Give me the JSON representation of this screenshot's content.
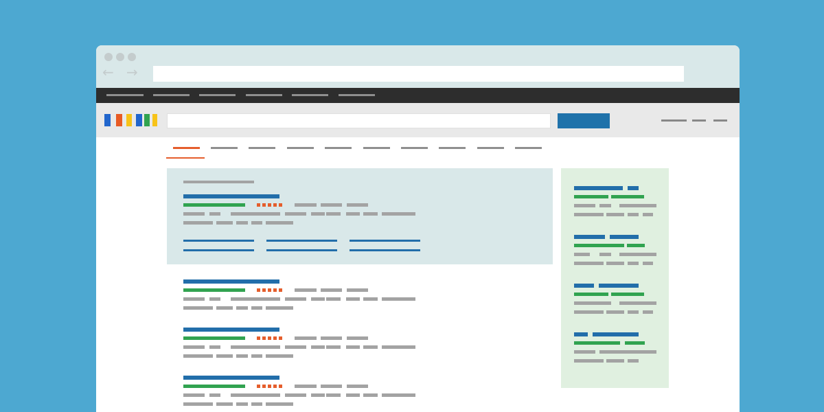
{
  "colors": {
    "background": "#4da8d1",
    "window": "#ffffff",
    "chrome": "#d9e8e9",
    "chrome_dot": "#c4cccd",
    "url_bar": "#ffffff",
    "top_nav": "#2d2d2d",
    "header": "#e9e9e9",
    "search_button": "#1f72aa",
    "accent_orange": "#e55e2c",
    "title_blue": "#226eaa",
    "url_green": "#31a350",
    "snippet_gray": "#a3a3a3",
    "featured_bg": "#d9e8e9",
    "sidebar_bg": "#e0f0e0"
  },
  "icons": {
    "back": "←",
    "forward": "→",
    "back_name": "arrow-left-icon",
    "forward_name": "arrow-right-icon"
  },
  "logo_colors": [
    "#2266cc",
    "#e85b24",
    "#f7c319",
    "#2266cc",
    "#31a350",
    "#f7c319"
  ],
  "tabs_count": 10,
  "active_tab_index": 0,
  "results_count": 4,
  "sidebar_cards_count": 4
}
